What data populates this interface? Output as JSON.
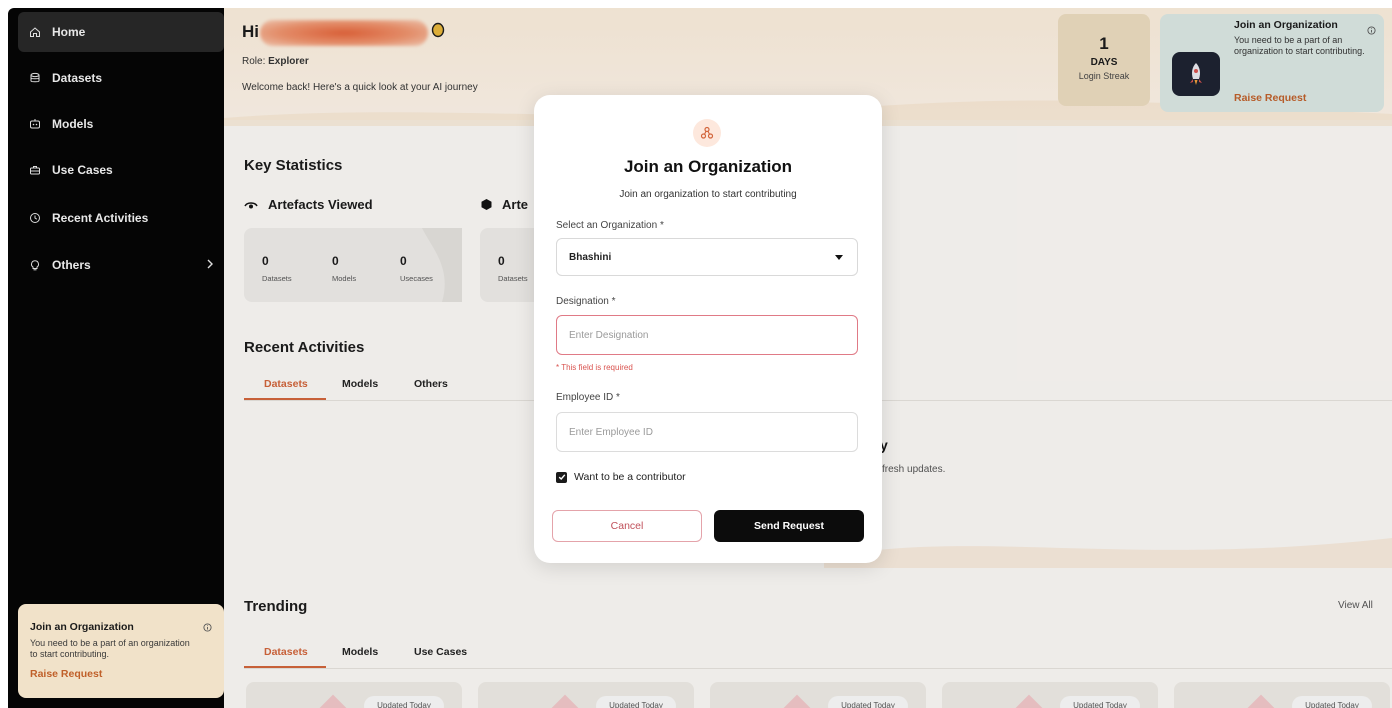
{
  "sidebar": {
    "items": [
      {
        "label": "Home",
        "icon": "home-icon",
        "active": true
      },
      {
        "label": "Datasets",
        "icon": "database-icon"
      },
      {
        "label": "Models",
        "icon": "model-icon"
      },
      {
        "label": "Use Cases",
        "icon": "briefcase-icon"
      },
      {
        "label": "Recent Activities",
        "icon": "clock-icon"
      },
      {
        "label": "Others",
        "icon": "lightbulb-icon"
      }
    ],
    "card": {
      "title": "Join an Organization",
      "desc": "You need to be a part of an organization to start contributing.",
      "link": "Raise Request"
    }
  },
  "header": {
    "greeting": "Hi",
    "role_label": "Role:",
    "role_value": "Explorer",
    "welcome": "Welcome back! Here's a quick look at your AI journey",
    "streak": {
      "value": "1",
      "unit": "DAYS",
      "label": "Login Streak"
    },
    "join_card": {
      "title": "Join an Organization",
      "desc": "You need to be a part of an organization to start contributing.",
      "link": "Raise Request"
    }
  },
  "key_stats": {
    "title": "Key Statistics",
    "artefacts_viewed": {
      "title": "Artefacts Viewed",
      "stats": [
        {
          "value": "0",
          "label": "Datasets"
        },
        {
          "value": "0",
          "label": "Models"
        },
        {
          "value": "0",
          "label": "Usecases"
        }
      ]
    },
    "second": {
      "title": "Arte",
      "stat_value": "0",
      "stat_label": "Datasets"
    }
  },
  "recent": {
    "title": "Recent Activities",
    "tabs": [
      "Datasets",
      "Models",
      "Others"
    ],
    "empty_peek_title": "y",
    "empty_peek_text": "fresh updates."
  },
  "trending": {
    "title": "Trending",
    "view_all": "View All",
    "tabs": [
      "Datasets",
      "Models",
      "Use Cases"
    ],
    "badge": "Updated Today"
  },
  "modal": {
    "title": "Join an Organization",
    "subtitle": "Join an organization to start contributing",
    "org_label": "Select an Organization *",
    "org_value": "Bhashini",
    "designation_label": "Designation *",
    "designation_placeholder": "Enter Designation",
    "designation_error": "* This field is required",
    "employee_label": "Employee ID *",
    "employee_placeholder": "Enter Employee ID",
    "contributor_label": "Want to be a contributor",
    "contributor_checked": true,
    "cancel_label": "Cancel",
    "send_label": "Send Request"
  },
  "colors": {
    "accent": "#d2643a",
    "sidebar_bg": "#050505",
    "error": "#d9534f"
  }
}
